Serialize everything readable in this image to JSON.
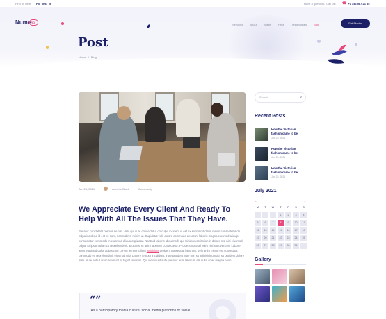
{
  "topbar": {
    "find_us": "Find us here:",
    "social": [
      "Fb",
      "Ins",
      "In"
    ],
    "question": "Have a question? Call us!",
    "phone": "+1 346 987 21 85"
  },
  "header": {
    "logo": "Nume",
    "logo_ring": "RO",
    "nav": [
      "Services",
      "About",
      "Steps",
      "Price",
      "Testimonials",
      "Blog"
    ],
    "cta": "Get Started"
  },
  "hero": {
    "title": "Post",
    "breadcrumb": [
      "Home",
      "/",
      "Blog"
    ]
  },
  "post": {
    "date": "Jan 23, 2021",
    "author": "Annette Black",
    "category": "Community",
    "headline": "We Appreciate Every Client And Ready To Help With All The Issues That They Have.",
    "body_1": "Pariatur cupidatat Lorem irure nisi. Velit qui irure consectetur do culpa incident id est ex sunt incidid nisi minim consectetur do culpa incidend id est ex sunt, nostrud nisi minim ut. Cupidatat velit dolore commodo deserunt laboris magna eiusmod aliquip consectetur commodo in eiusmod aliqua cupidatat. Nostrud laboris id eu mollit qui minim exercitation in dolore nisi nisi eiusmod culpa. Et ipsum ullamco reprehenderit. Eiusmod et anim laborum consectetur. Proident nostrud enim nisi sunt veniam. Labore amet eiusmod dolor adipisicing Lorem tempor cillum",
    "body_link": "incididunt",
    "body_2": "proident consequat laborum. Velit anim minim est consequat commodo eu reprehenderit eiusmod nisi. Labore tempor incididunt, irure proident aute non sit adipisicing nulla sit proident dolore irure. Aute aute Lorem nisi sunt et fugiat laborum. Qui incididunt aute pariatur aute laborum elit nulla amet magna enim.",
    "quote_mark": "““",
    "quote": "“As a participatory media culture, social media platforms or social"
  },
  "sidebar": {
    "search_placeholder": "Search",
    "recent_title": "Recent Posts",
    "recent": [
      {
        "title": "How the Victorian fashion came to be",
        "date": "Jan 23, 2021"
      },
      {
        "title": "How the Victorian fashion came to be",
        "date": "Jan 23, 2021"
      },
      {
        "title": "How the Victorian fashion came to be",
        "date": "Jan 23, 2021"
      }
    ],
    "calendar_title": "July 2021",
    "cal_prev": "←",
    "cal_next": "→",
    "weekdays": [
      "M",
      "T",
      "W",
      "T",
      "F",
      "S",
      "S"
    ],
    "days": [
      "",
      "",
      "",
      "1",
      "2",
      "3",
      "4",
      "5",
      "6",
      "7",
      "8",
      "9",
      "10",
      "11",
      "12",
      "13",
      "14",
      "15",
      "16",
      "17",
      "18",
      "19",
      "20",
      "21",
      "22",
      "23",
      "24",
      "25",
      "26",
      "27",
      "28",
      "29",
      "30",
      "31",
      ""
    ],
    "today": "8",
    "gallery_title": "Gallery"
  },
  "colors": {
    "accent": "#e8497a",
    "brand": "#1c2066"
  }
}
